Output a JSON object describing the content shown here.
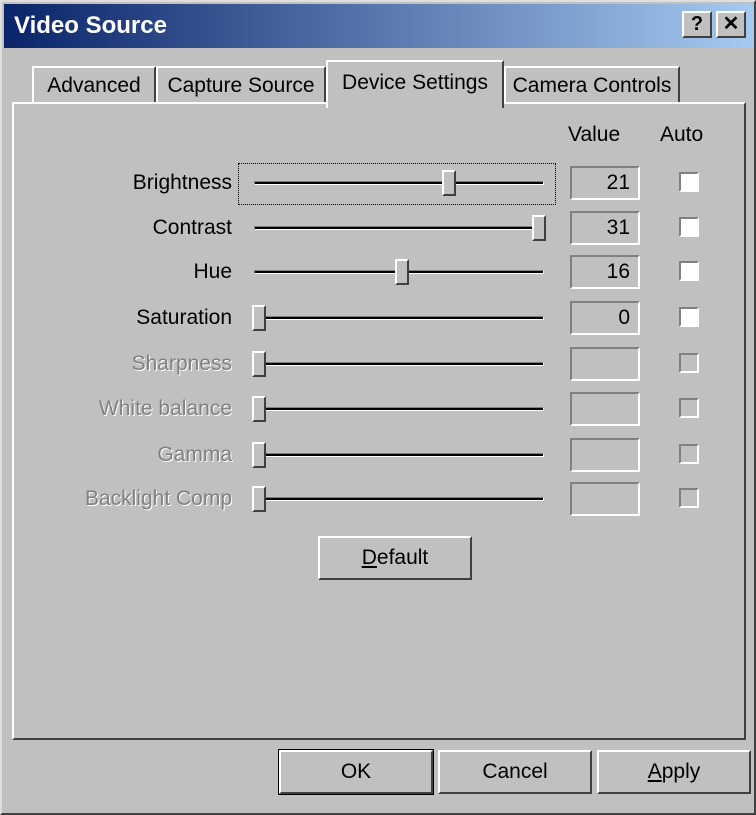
{
  "window": {
    "title": "Video Source",
    "help_glyph": "?",
    "close_glyph": "✕"
  },
  "tabs": [
    {
      "label": "Advanced",
      "active": false
    },
    {
      "label": "Capture Source",
      "active": false
    },
    {
      "label": "Device Settings",
      "active": true
    },
    {
      "label": "Camera Controls",
      "active": false
    }
  ],
  "headers": {
    "value": "Value",
    "auto": "Auto"
  },
  "settings": [
    {
      "label": "Brightness",
      "value": "21",
      "slider_fraction": 0.68,
      "enabled": true,
      "auto": false
    },
    {
      "label": "Contrast",
      "value": "31",
      "slider_fraction": 1.0,
      "enabled": true,
      "auto": false
    },
    {
      "label": "Hue",
      "value": "16",
      "slider_fraction": 0.51,
      "enabled": true,
      "auto": false
    },
    {
      "label": "Saturation",
      "value": "0",
      "slider_fraction": 0.0,
      "enabled": true,
      "auto": false
    },
    {
      "label": "Sharpness",
      "value": "",
      "slider_fraction": 0.0,
      "enabled": false,
      "auto": false
    },
    {
      "label": "White balance",
      "value": "",
      "slider_fraction": 0.0,
      "enabled": false,
      "auto": false
    },
    {
      "label": "Gamma",
      "value": "",
      "slider_fraction": 0.0,
      "enabled": false,
      "auto": false
    },
    {
      "label": "Backlight Comp",
      "value": "",
      "slider_fraction": 0.0,
      "enabled": false,
      "auto": false
    }
  ],
  "default_button": {
    "mnemonic": "D",
    "rest": "efault"
  },
  "buttons": {
    "ok": "OK",
    "cancel": "Cancel",
    "apply_mnemonic": "A",
    "apply_rest": "pply"
  },
  "colors": {
    "title_start": "#0a246a",
    "title_end": "#a6caf0",
    "face": "#c0c0c0",
    "disabled_text": "#808080"
  }
}
